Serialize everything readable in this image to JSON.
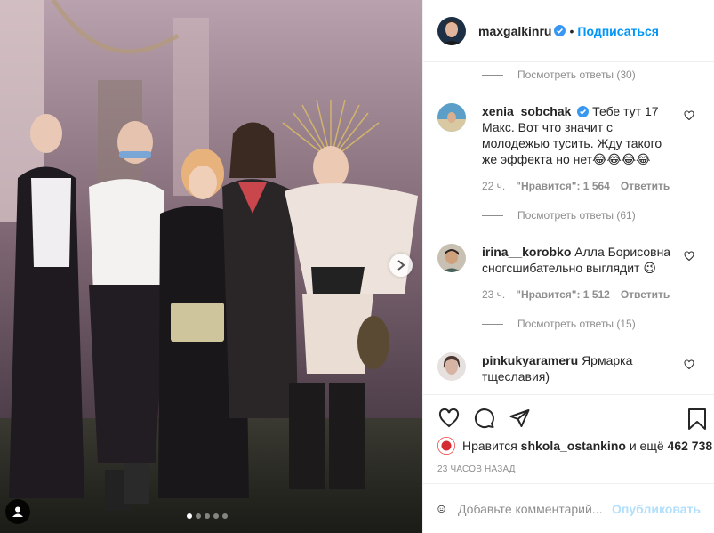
{
  "post": {
    "author": "maxgalkinru",
    "follow_label": "Подписаться",
    "separator": "•",
    "carousel_total": 5,
    "carousel_active": 0
  },
  "comments": {
    "top_replies": "Посмотреть ответы (30)",
    "items": [
      {
        "user": "xenia_sobchak",
        "verified": true,
        "text": "Тебе тут 17 Макс. Вот что значит с молодежью тусить. Жду такого же эффекта но нет😂😂😂😂",
        "time": "22 ч.",
        "likes": "\"Нравится\": 1 564",
        "reply": "Ответить",
        "replies": "Посмотреть ответы (61)"
      },
      {
        "user": "irina__korobko",
        "verified": false,
        "text": "Алла Борисовна сногсшибательно выглядит 😉",
        "time": "23 ч.",
        "likes": "\"Нравится\": 1 512",
        "reply": "Ответить",
        "replies": "Посмотреть ответы (15)"
      },
      {
        "user": "pinkukyarameru",
        "verified": false,
        "text": "Ярмарка тщеславия)",
        "time": "",
        "likes": "",
        "reply": "",
        "replies": ""
      }
    ]
  },
  "actions": {
    "icons": [
      "heart-icon",
      "comment-icon",
      "share-icon",
      "bookmark-icon"
    ],
    "liked_by_prefix": "Нравится",
    "liked_by_user": "shkola_ostankino",
    "liked_by_suffix": "и ещё",
    "liked_by_count": "462 738",
    "time_ago": "23 ЧАСОВ НАЗАД"
  },
  "add_comment": {
    "placeholder": "Добавьте комментарий...",
    "publish_label": "Опубликовать"
  },
  "colors": {
    "accent": "#0095f6",
    "publish_disabled": "#b2dffc",
    "muted": "#8e8e8e",
    "text": "#262626",
    "border": "#efefef"
  }
}
